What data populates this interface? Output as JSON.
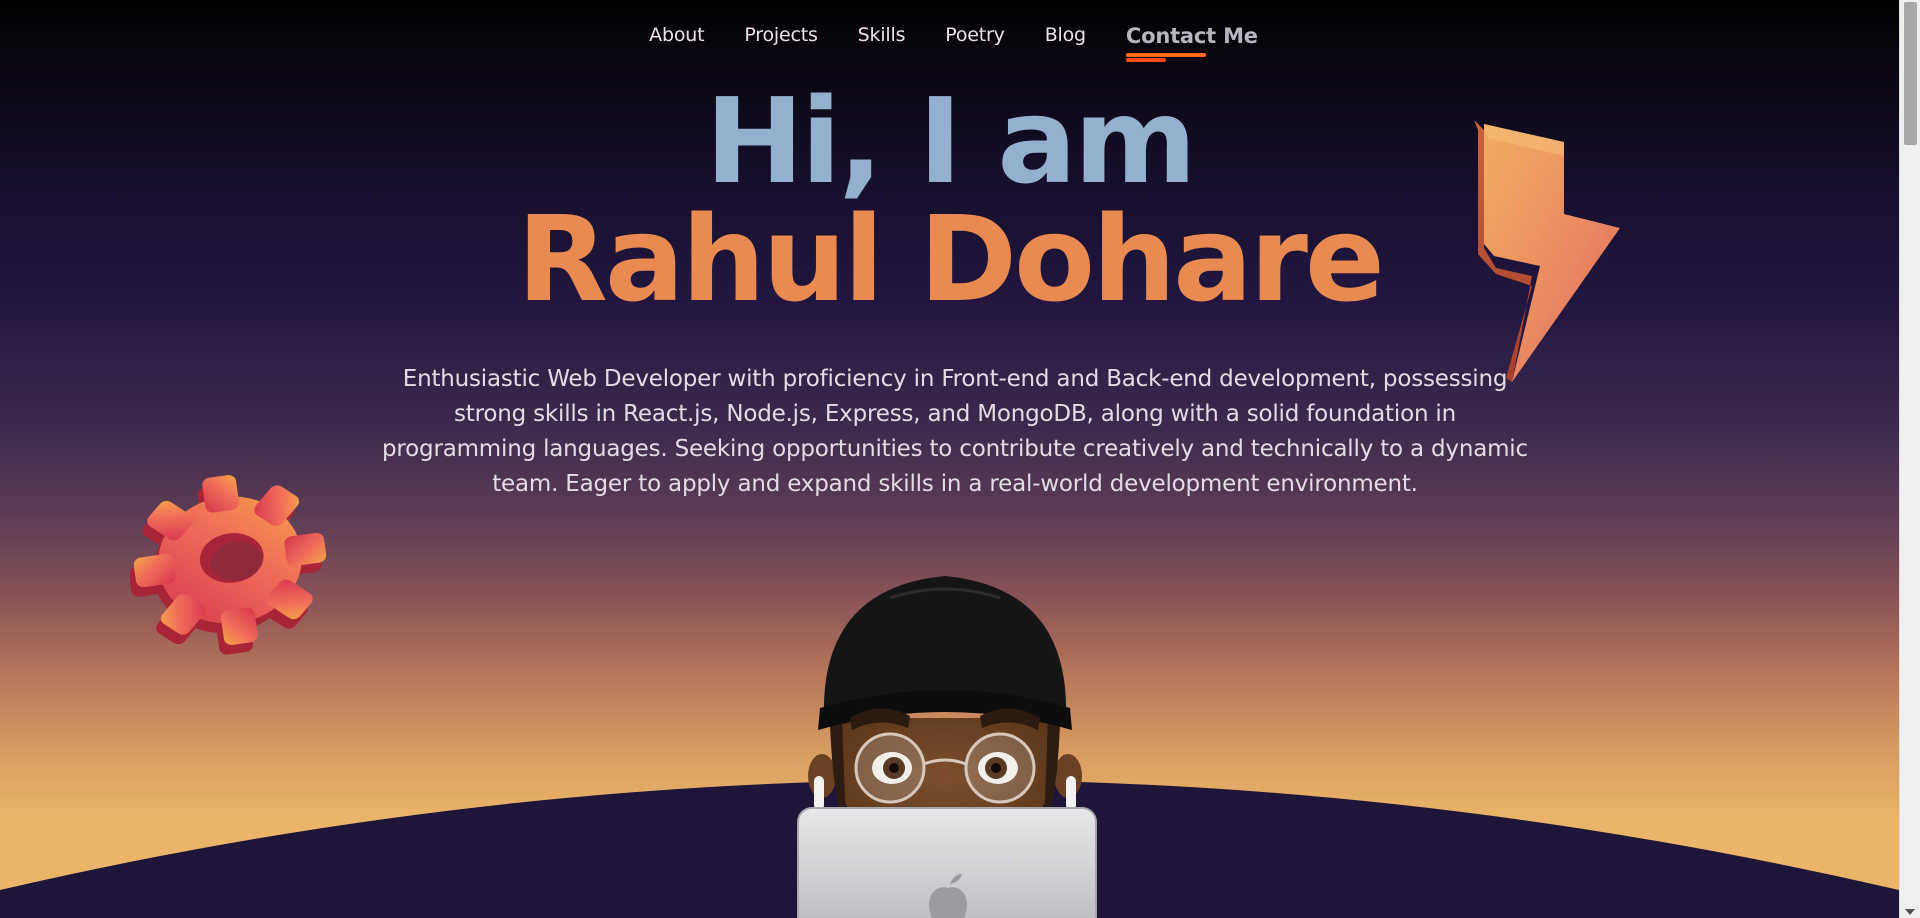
{
  "nav": {
    "items": [
      {
        "label": "About"
      },
      {
        "label": "Projects"
      },
      {
        "label": "Skills"
      },
      {
        "label": "Poetry"
      },
      {
        "label": "Blog"
      },
      {
        "label": "Contact Me"
      }
    ]
  },
  "hero": {
    "greeting": "Hi, I am",
    "name": "Rahul Dohare",
    "bio": "Enthusiastic Web Developer with proficiency in Front-end and Back-end development, possessing strong skills in React.js, Node.js, Express, and MongoDB, along with a solid foundation in programming languages. Seeking opportunities to contribute creatively and technically to a dynamic team. Eager to apply and expand skills in a real-world development environment."
  },
  "decorations": {
    "bolt_icon": "lightning-bolt-icon",
    "gear_icon": "gear-icon",
    "avatar": "memoji-avatar-with-laptop",
    "laptop_logo": "apple-logo-icon"
  },
  "colors": {
    "greeting": "#94b0cf",
    "name": "#e98a52",
    "nav_active_underline": "#ff6a1a",
    "horizon": "#1f1538"
  }
}
